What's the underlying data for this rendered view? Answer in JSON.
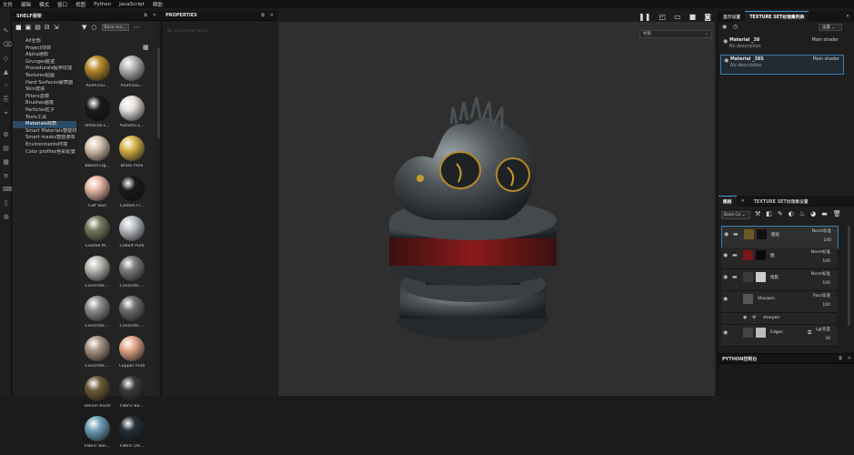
{
  "menubar": [
    "文件",
    "编辑",
    "模式",
    "窗口",
    "视图",
    "Python",
    "JavaScript",
    "帮助"
  ],
  "shelf": {
    "title": "SHELF展架",
    "categories": [
      "All全部",
      "Project项目",
      "Alpha通知",
      "Grunges脏迹",
      "Procedurals程序纹理",
      "Textures贴图",
      "Hard Surfaces硬表面",
      "Skin皮肤",
      "Filters滤镜",
      "Brushes画笔",
      "Particles粒子",
      "Tools工具",
      "Materials材质",
      "Smart Materials智能材",
      "Smart masks智能遮罩",
      "Environments环境",
      "Color profiles色彩配置"
    ],
    "selected_category": "Materials材质",
    "search_value": "Base ma...",
    "materials": [
      {
        "label": "Aluminiu...",
        "color": "#b98a2c"
      },
      {
        "label": "Aluminiu...",
        "color": "#b4b4b4"
      },
      {
        "label": "Artificial L...",
        "color": "#1a1a1a"
      },
      {
        "label": "Autumn L...",
        "color": "#e4e0dc"
      },
      {
        "label": "Baked Lig...",
        "color": "#d7c3ae"
      },
      {
        "label": "Brass Pure",
        "color": "#d9b54a"
      },
      {
        "label": "Calf Skin",
        "color": "#e7b8a5"
      },
      {
        "label": "Carbon Fi...",
        "color": "#1a1a1a"
      },
      {
        "label": "Coated M...",
        "color": "#787a5e"
      },
      {
        "label": "Cobalt Pure",
        "color": "#bcc0c6"
      },
      {
        "label": "Concrete ...",
        "color": "#bab9b4"
      },
      {
        "label": "Concrete ...",
        "color": "#7d7d7a"
      },
      {
        "label": "Concrete ...",
        "color": "#8e8e8e"
      },
      {
        "label": "Concrete ...",
        "color": "#6f706d"
      },
      {
        "label": "Concrete ...",
        "color": "#a99583"
      },
      {
        "label": "Copper Pure",
        "color": "#e2a88a"
      },
      {
        "label": "Denim Rivet",
        "color": "#6d5a3a"
      },
      {
        "label": "Fabric Ba...",
        "color": "#3a3a3a"
      },
      {
        "label": "Fabric Bas...",
        "color": "#6ea0b6"
      },
      {
        "label": "Fabric De...",
        "color": "#243038"
      }
    ]
  },
  "properties": {
    "title": "PROPERTIES",
    "hint": "No properties found"
  },
  "viewport": {
    "mode_dropdown": "材质"
  },
  "texture_sets": {
    "tabs": [
      "显示设置",
      "TEXTURE SET纹理集列表"
    ],
    "settings_btn": "设置",
    "items": [
      {
        "name": "Material _38",
        "desc": "No description",
        "shader": "Main shader"
      },
      {
        "name": "Material _38S",
        "desc": "No description",
        "shader": "Main shader"
      }
    ]
  },
  "layers": {
    "tabs": [
      "图层",
      "TEXTURE SET纹理集设置"
    ],
    "channel_select": "Base Co",
    "items": [
      {
        "name": "图层",
        "blend": "Norm标准",
        "opacity": "100",
        "thumb1": "#6b5a22",
        "thumb2": "#111111",
        "type": "folder"
      },
      {
        "name": "图",
        "blend": "Norm标准",
        "opacity": "100",
        "thumb1": "#7a1616",
        "thumb2": "#0b0b0b",
        "type": "folder"
      },
      {
        "name": "暗影",
        "blend": "Norm标准",
        "opacity": "100",
        "thumb1": "#3a3a3a",
        "thumb2": "#cccccc",
        "type": "folder"
      },
      {
        "name": "Sharpen",
        "blend": "Pass穿透",
        "opacity": "100",
        "thumb1": "#555555",
        "thumb2": "",
        "type": "fill"
      },
      {
        "name": "sharpen",
        "blend": "",
        "opacity": "",
        "thumb1": "",
        "thumb2": "",
        "type": "filter"
      },
      {
        "name": "Edges",
        "blend": "Lgt亮度",
        "opacity": "30",
        "thumb1": "#444444",
        "thumb2": "#bbbbbb",
        "type": "fill"
      }
    ]
  },
  "python": {
    "title": "PYTHON控制台"
  }
}
